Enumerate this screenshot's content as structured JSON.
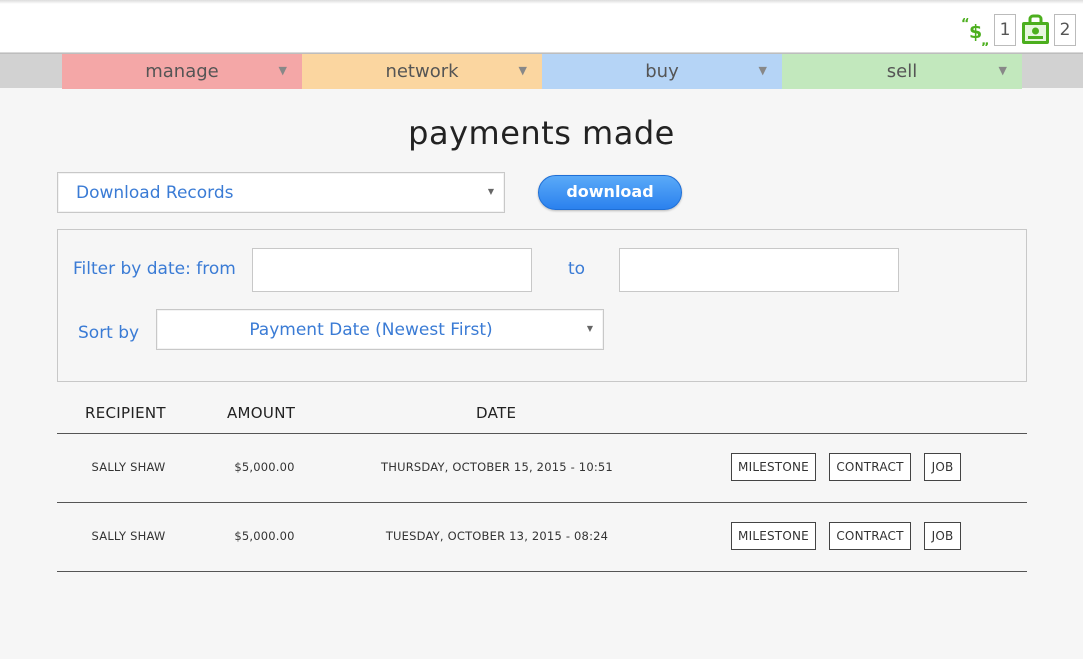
{
  "header": {
    "notifications": [
      {
        "icon": "payments-icon",
        "count": "1"
      },
      {
        "icon": "jobs-icon",
        "count": "2"
      }
    ]
  },
  "nav": {
    "items": [
      {
        "label": "manage",
        "color": "#f4a7a7"
      },
      {
        "label": "network",
        "color": "#fbd6a0"
      },
      {
        "label": "buy",
        "color": "#b5d4f6"
      },
      {
        "label": "sell",
        "color": "#c2e8bd"
      }
    ],
    "arrow": "▼"
  },
  "page": {
    "title": "payments made"
  },
  "records": {
    "select_value": "Download Records",
    "download_label": "download"
  },
  "filter": {
    "date_label": "Filter by date: from",
    "to_label": "to",
    "from_value": "",
    "to_value": "",
    "sort_label": "Sort by",
    "sort_value": "Payment Date (Newest First)"
  },
  "table": {
    "headers": {
      "recipient": "RECIPIENT",
      "amount": "AMOUNT",
      "date": "DATE"
    },
    "rows": [
      {
        "recipient": "SALLY SHAW",
        "amount": "$5,000.00",
        "date": "THURSDAY, OCTOBER 15, 2015 - 10:51",
        "links": [
          "MILESTONE",
          "CONTRACT",
          "JOB"
        ]
      },
      {
        "recipient": "SALLY SHAW",
        "amount": "$5,000.00",
        "date": "TUESDAY, OCTOBER 13, 2015 - 08:24",
        "links": [
          "MILESTONE",
          "CONTRACT",
          "JOB"
        ]
      }
    ]
  },
  "colors": {
    "accent": "#3a7bd5",
    "icon_green": "#4caf1e",
    "button_blue": "#2b81ee"
  }
}
